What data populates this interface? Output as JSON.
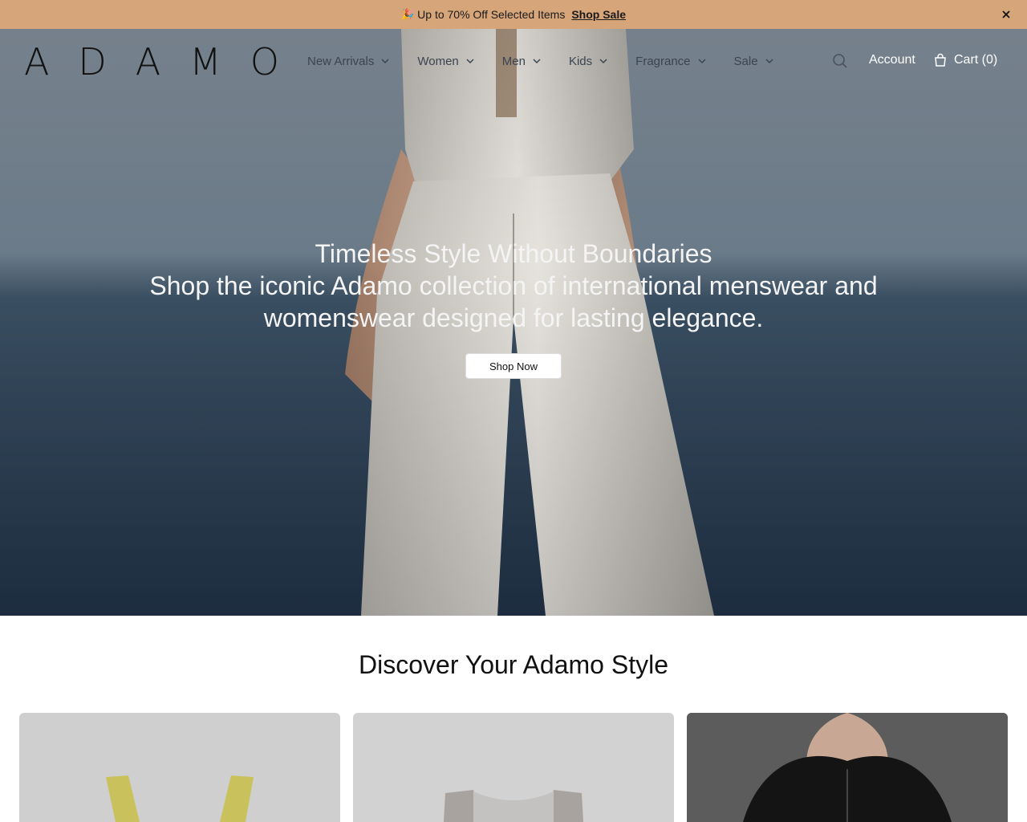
{
  "announcement": {
    "emoji": "🎉",
    "text": "Up to 70% Off Selected Items",
    "link_label": "Shop Sale",
    "close_label": "✕"
  },
  "header": {
    "logo_letters": [
      "A",
      "D",
      "A",
      "M",
      "O"
    ],
    "nav": [
      {
        "label": "New Arrivals"
      },
      {
        "label": "Women"
      },
      {
        "label": "Men"
      },
      {
        "label": "Kids"
      },
      {
        "label": "Fragrance"
      },
      {
        "label": "Sale"
      }
    ],
    "search_icon": "search-icon",
    "account_label": "Account",
    "cart_label": "Cart (0)"
  },
  "hero": {
    "title": "Timeless Style Without Boundaries",
    "subtitle": "Shop the iconic Adamo collection of international menswear and womenswear designed for lasting elegance.",
    "cta_label": "Shop Now"
  },
  "discover": {
    "title": "Discover Your Adamo Style",
    "cards": [
      {
        "name": "yellow-top-card"
      },
      {
        "name": "embellished-top-card"
      },
      {
        "name": "black-hoodie-card"
      }
    ]
  },
  "colors": {
    "announcement_bg": "#d6a57a",
    "nav_text": "#3b4450",
    "hero_text": "#f4f4f4"
  }
}
